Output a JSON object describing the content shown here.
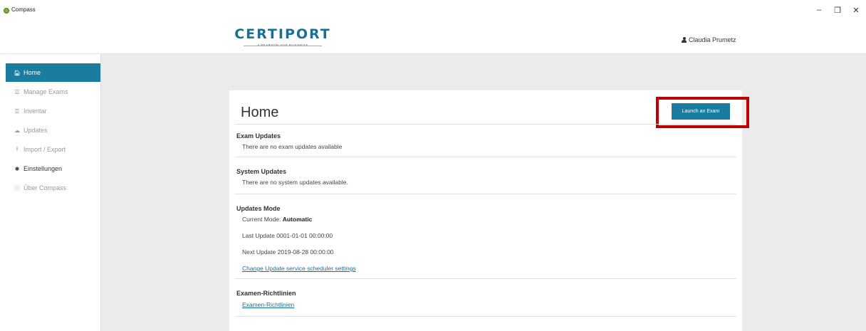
{
  "window": {
    "title": "Compass",
    "controls": {
      "minimize": "–",
      "maximize": "❐",
      "close": "✕"
    }
  },
  "header": {
    "logo": {
      "main": "CERTIPORT",
      "sub": "A PEARSON VUE BUSINESS"
    },
    "user_name": "Claudia Prumetz"
  },
  "sidebar": {
    "items": [
      {
        "label": "Home",
        "icon": "home-icon",
        "glyph": "🏠︎"
      },
      {
        "label": "Manage Exams",
        "icon": "list-icon",
        "glyph": "☰"
      },
      {
        "label": "Inventar",
        "icon": "list-icon",
        "glyph": "☰"
      },
      {
        "label": "Updates",
        "icon": "cloud-icon",
        "glyph": "☁"
      },
      {
        "label": "Import / Export",
        "icon": "download-icon",
        "glyph": "⭳"
      },
      {
        "label": "Einstellungen",
        "icon": "gear-icon",
        "glyph": "✱"
      },
      {
        "label": "Über Compass",
        "icon": "info-icon",
        "glyph": "ⓘ"
      }
    ]
  },
  "main": {
    "title": "Home",
    "launch_button": "Launch an Exam",
    "sections": {
      "exam_updates": {
        "heading": "Exam Updates",
        "text": "There are no exam updates available"
      },
      "system_updates": {
        "heading": "System Updates",
        "text": "There are no system updates available."
      },
      "updates_mode": {
        "heading": "Updates Mode",
        "current_mode_label": "Current Mode:",
        "current_mode_value": "Automatic",
        "last_update": "Last Update 0001-01-01 00:00:00",
        "next_update": "Next Update 2019-08-28 00:00:00",
        "link": "Change Update service scheduler settings"
      },
      "exam_policies": {
        "heading": "Examen-Richtlinien",
        "link": "Examen-Richtlinien"
      }
    }
  },
  "colors": {
    "accent": "#1a7c9e",
    "highlight": "#c00000",
    "background": "#ebebeb",
    "link": "#1a6f96"
  }
}
